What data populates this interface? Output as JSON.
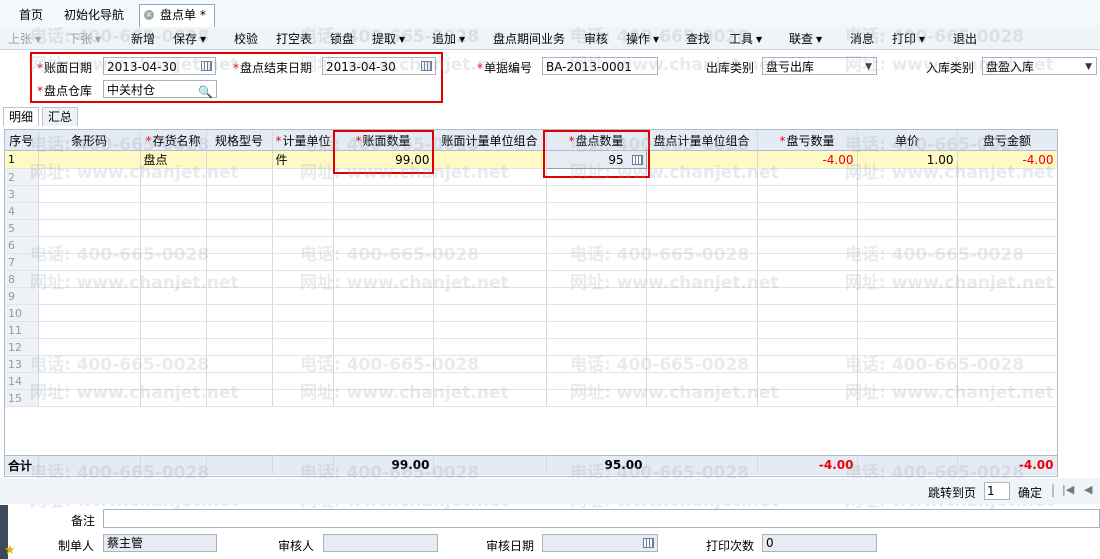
{
  "tabs": [
    {
      "label": "首页"
    },
    {
      "label": "初始化导航"
    },
    {
      "label": "盘点单 *"
    }
  ],
  "toolbar": {
    "prev": "上张",
    "next": "下张",
    "new": "新增",
    "save": "保存",
    "verify": "校验",
    "print_blank": "打空表",
    "lock": "锁盘",
    "fetch": "提取",
    "append": "追加",
    "period_biz": "盘点期间业务",
    "audit": "审核",
    "operate": "操作",
    "find": "查找",
    "tools": "工具",
    "link": "联查",
    "message": "消息",
    "print": "打印",
    "exit": "退出"
  },
  "header": {
    "book_date_label": "账面日期",
    "book_date": "2013-04-30",
    "end_date_label": "盘点结束日期",
    "end_date": "2013-04-30",
    "doc_no_label": "单据编号",
    "doc_no": "BA-2013-0001",
    "out_type_label": "出库类别",
    "out_type": "盘亏出库",
    "in_type_label": "入库类别",
    "in_type": "盘盈入库",
    "warehouse_label": "盘点仓库",
    "warehouse": "中关村仓"
  },
  "subtabs": {
    "detail": "明细",
    "summary": "汇总"
  },
  "grid": {
    "headers": {
      "seq": "序号",
      "barcode": "条形码",
      "name": "存货名称",
      "spec": "规格型号",
      "unit": "计量单位",
      "book_qty": "账面数量",
      "book_unit_combo": "账面计量单位组合",
      "count_qty": "盘点数量",
      "count_unit_combo": "盘点计量单位组合",
      "loss_qty": "盘亏数量",
      "price": "单价",
      "loss_amount": "盘亏金额"
    },
    "row1": {
      "seq": "1",
      "barcode": "",
      "name": "盘点",
      "spec": "",
      "unit": "件",
      "book_qty": "99.00",
      "book_unit_combo": "",
      "count_qty": "95",
      "count_unit_combo": "",
      "loss_qty": "-4.00",
      "price": "1.00",
      "loss_amount": "-4.00"
    },
    "empty_rows": [
      "2",
      "3",
      "4",
      "5",
      "6",
      "7",
      "8",
      "9",
      "10",
      "11",
      "12",
      "13",
      "14",
      "15"
    ],
    "total": {
      "label": "合计",
      "book_qty": "99.00",
      "count_qty": "95.00",
      "loss_qty": "-4.00",
      "loss_amount": "-4.00"
    }
  },
  "watermark": {
    "phone": "电话: 400-665-0028",
    "site": "网址: www.chanjet.net"
  },
  "pager": {
    "jump_label": "跳转到页",
    "page": "1",
    "confirm": "确定"
  },
  "footer": {
    "remark_label": "备注",
    "remark": "",
    "maker_label": "制单人",
    "maker": "蔡主管",
    "auditor_label": "审核人",
    "auditor": "",
    "audit_date_label": "审核日期",
    "audit_date": "",
    "print_count_label": "打印次数",
    "print_count": "0"
  },
  "colors": {
    "required": "#e00000",
    "highlight_row": "#fff9c4",
    "negative": "#e00000"
  }
}
